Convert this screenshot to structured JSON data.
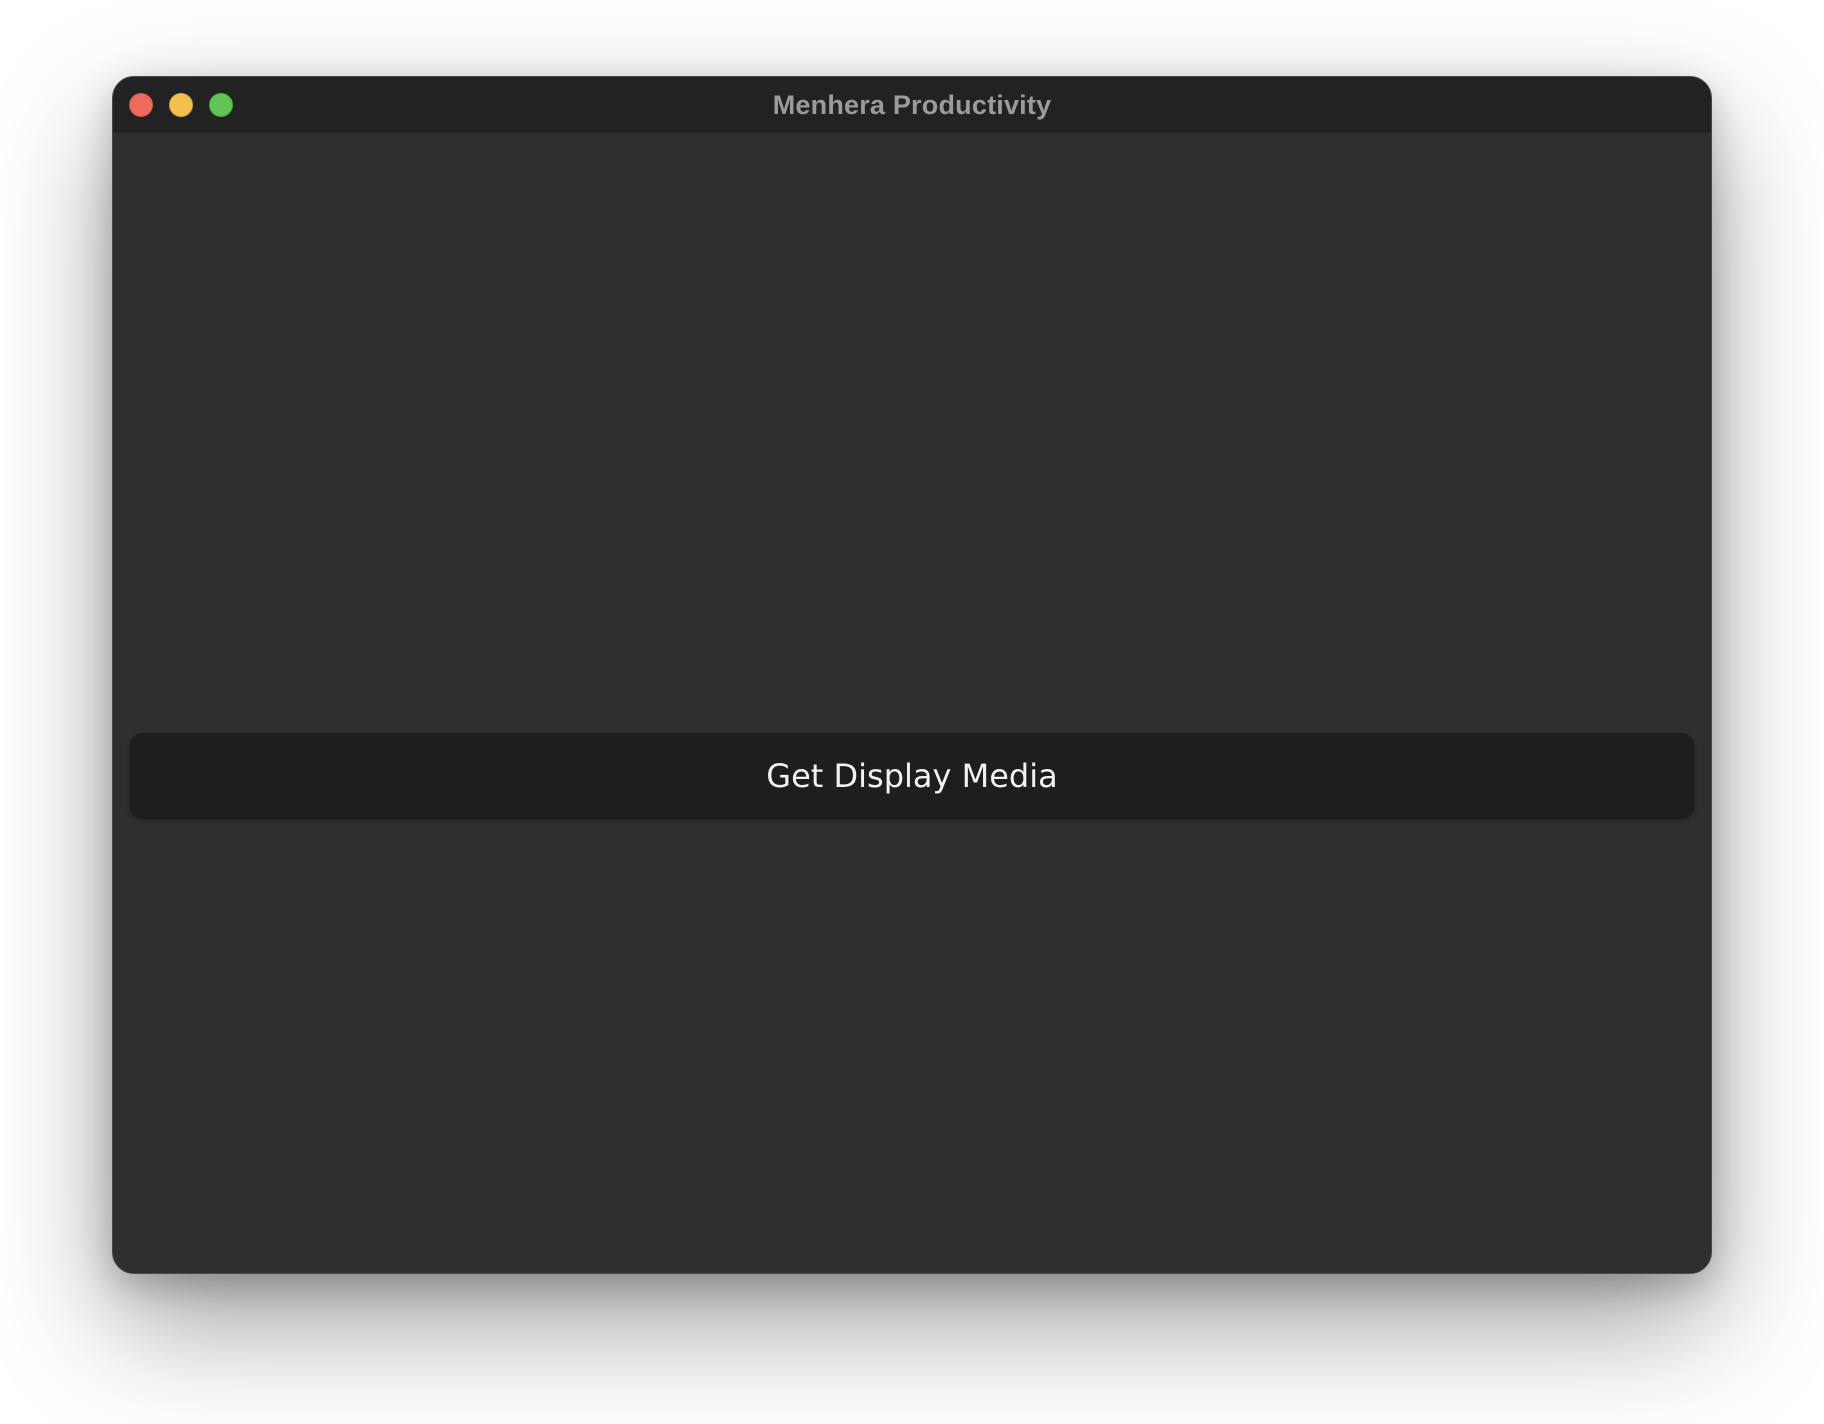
{
  "window": {
    "title": "Menhera Productivity",
    "controls": {
      "close": "close-icon",
      "minimize": "minimize-icon",
      "maximize": "maximize-icon"
    },
    "colors": {
      "close": "#ec6a5e",
      "minimize": "#f4bf4f",
      "maximize": "#61c554",
      "background": "#2f2f2f",
      "titlebar": "#222222"
    }
  },
  "main": {
    "get_display_media_label": "Get Display Media"
  }
}
